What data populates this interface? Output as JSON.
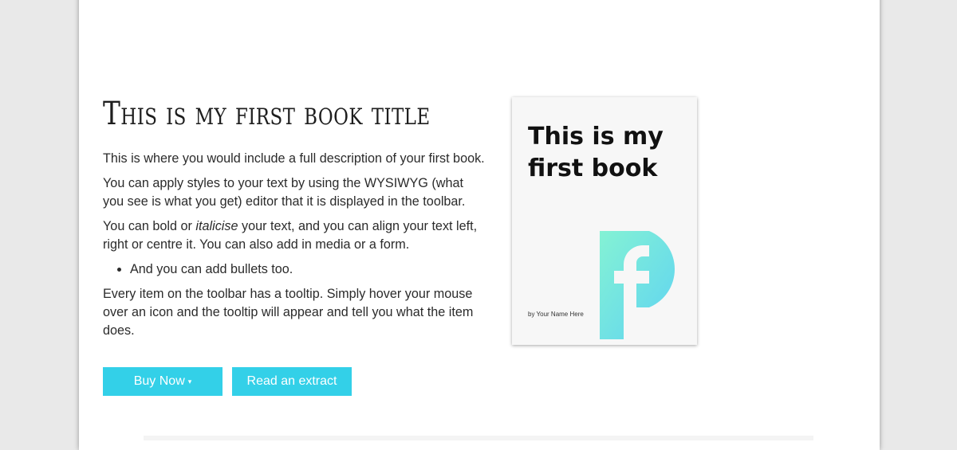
{
  "book": {
    "title": "This is my first book title",
    "description": {
      "p1": "This is where you would include a full description of your first book.",
      "p2": "You can apply styles to your text by using the WYSIWYG (what you see is what you get) editor that it is displayed in the toolbar.",
      "p3_before": "You can bold or ",
      "p3_italic": "italicise",
      "p3_after": " your text, and you can align your text left, right or centre it. You can also add in media or a form.",
      "bullet": "And you can add bullets too.",
      "p4": "Every item on the toolbar has a tooltip. Simply hover your mouse over an icon and the tooltip will appear and tell you what the item does."
    }
  },
  "buttons": {
    "buy_label": "Buy Now",
    "caret": "▾",
    "extract_label": "Read an extract"
  },
  "cover": {
    "title": "This is my first book",
    "author": "by Your Name Here",
    "logo_icon": "f-logo-icon"
  },
  "colors": {
    "accent": "#33d0e8",
    "logo_gradient_start": "#7df0d6",
    "logo_gradient_end": "#62d6f0"
  }
}
